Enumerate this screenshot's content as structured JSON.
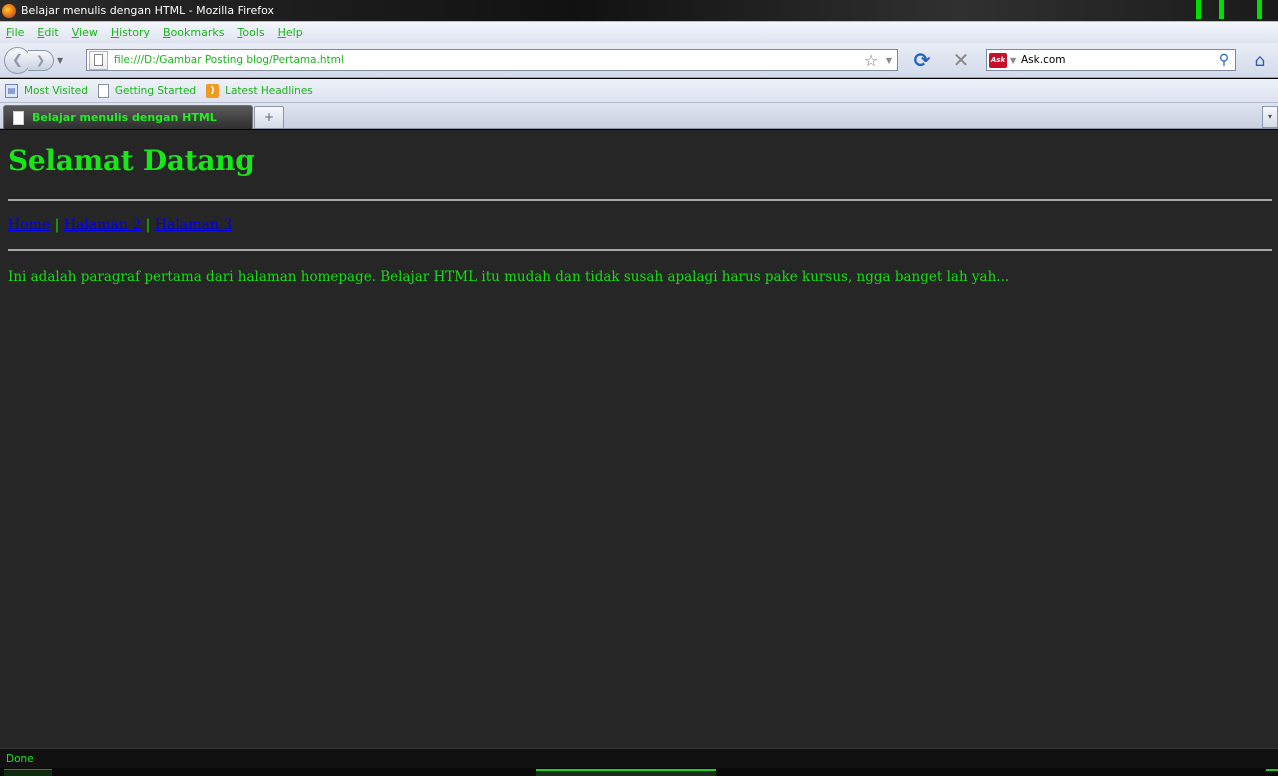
{
  "window": {
    "title": "Belajar menulis dengan HTML - Mozilla Firefox"
  },
  "menu": {
    "items": [
      "File",
      "Edit",
      "View",
      "History",
      "Bookmarks",
      "Tools",
      "Help"
    ]
  },
  "navigation": {
    "back_icon": "back-arrow-icon",
    "forward_icon": "forward-arrow-icon",
    "url": "file:///D:/Gambar Posting blog/Pertama.html",
    "search_value": "Ask.com",
    "search_engine_label": "Ask",
    "reload_glyph": "⟳",
    "stop_glyph": "✕",
    "home_glyph": "⌂"
  },
  "bookmarks": {
    "items": [
      "Most Visited",
      "Getting Started",
      "Latest Headlines"
    ]
  },
  "tabs": {
    "active_label": "Belajar menulis dengan HTML",
    "new_tab_glyph": "+",
    "all_tabs_glyph": "▾"
  },
  "page": {
    "heading": "Selamat Datang",
    "links": [
      "Home",
      "Halaman 2",
      "Halaman 3"
    ],
    "separator": " | ",
    "paragraph": "Ini adalah paragraf pertama dari halaman homepage. Belajar HTML itu mudah dan tidak susah apalagi harus pake kursus, ngga banget lah yah..."
  },
  "status": {
    "text": "Done"
  },
  "colors": {
    "accent_text": "#19e619",
    "page_background": "#262626",
    "link": "#0000ee"
  }
}
